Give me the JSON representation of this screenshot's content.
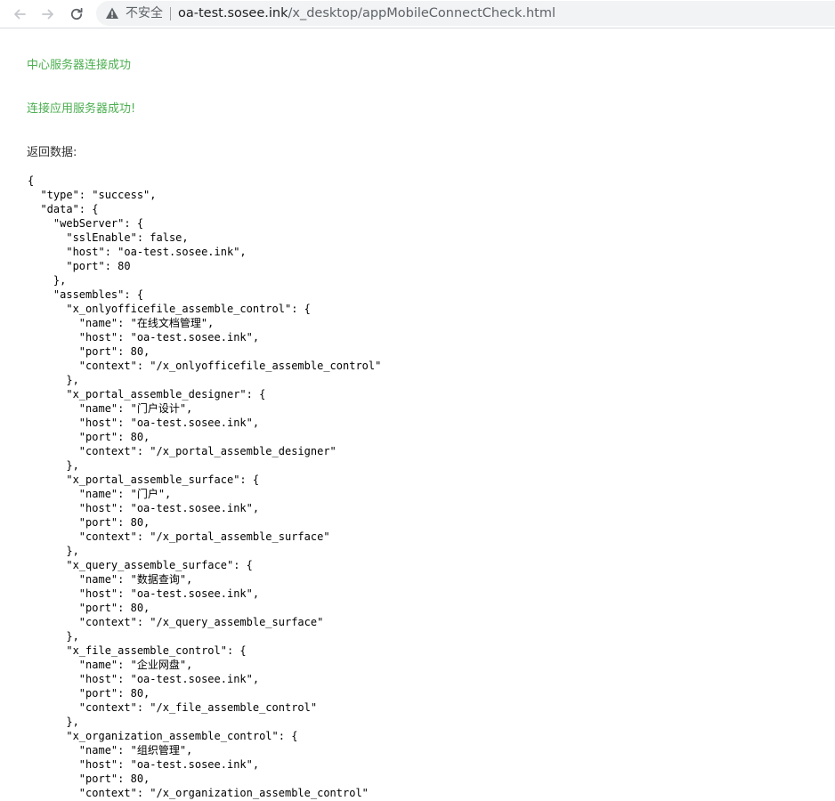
{
  "browser": {
    "security_label": "不安全",
    "url_host": "oa-test.sosee.ink",
    "url_path": "/x_desktop/appMobileConnectCheck.html",
    "icons": {
      "back": "arrow-left-icon",
      "forward": "arrow-right-icon",
      "reload": "reload-icon",
      "security": "warning-triangle-icon"
    }
  },
  "page": {
    "center_status": "中心服务器连接成功",
    "app_status": "连接应用服务器成功!",
    "return_label": "返回数据:",
    "success_color": "#4caf50",
    "json_text": "{\n  \"type\": \"success\",\n  \"data\": {\n    \"webServer\": {\n      \"sslEnable\": false,\n      \"host\": \"oa-test.sosee.ink\",\n      \"port\": 80\n    },\n    \"assembles\": {\n      \"x_onlyofficefile_assemble_control\": {\n        \"name\": \"在线文档管理\",\n        \"host\": \"oa-test.sosee.ink\",\n        \"port\": 80,\n        \"context\": \"/x_onlyofficefile_assemble_control\"\n      },\n      \"x_portal_assemble_designer\": {\n        \"name\": \"门户设计\",\n        \"host\": \"oa-test.sosee.ink\",\n        \"port\": 80,\n        \"context\": \"/x_portal_assemble_designer\"\n      },\n      \"x_portal_assemble_surface\": {\n        \"name\": \"门户\",\n        \"host\": \"oa-test.sosee.ink\",\n        \"port\": 80,\n        \"context\": \"/x_portal_assemble_surface\"\n      },\n      \"x_query_assemble_surface\": {\n        \"name\": \"数据查询\",\n        \"host\": \"oa-test.sosee.ink\",\n        \"port\": 80,\n        \"context\": \"/x_query_assemble_surface\"\n      },\n      \"x_file_assemble_control\": {\n        \"name\": \"企业网盘\",\n        \"host\": \"oa-test.sosee.ink\",\n        \"port\": 80,\n        \"context\": \"/x_file_assemble_control\"\n      },\n      \"x_organization_assemble_control\": {\n        \"name\": \"组织管理\",\n        \"host\": \"oa-test.sosee.ink\",\n        \"port\": 80,\n        \"context\": \"/x_organization_assemble_control\""
  }
}
